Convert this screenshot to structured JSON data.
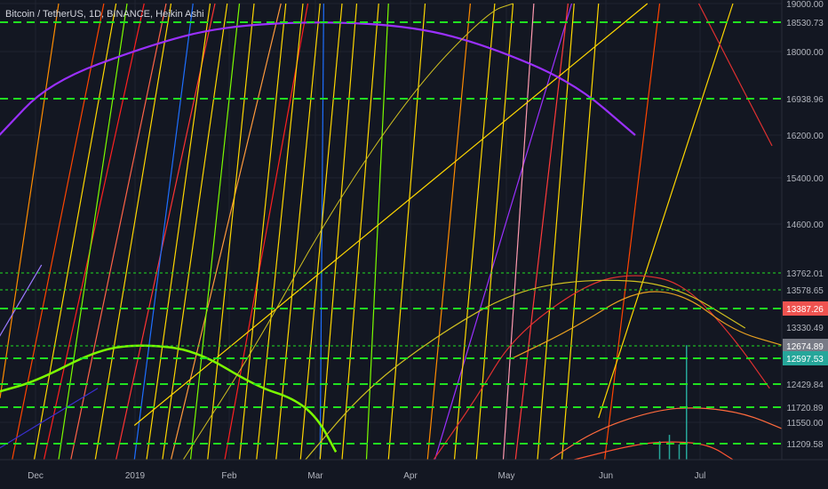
{
  "title": "Bitcoin / TetherUS, 1D, BINANCE, Heikin Ashi",
  "colors": {
    "background": "#131722",
    "axis_bg": "#1e222d",
    "axis_text": "#b2b5be",
    "grid": "#1f2330",
    "level_green": "#21e021",
    "price_red": "#ef5350",
    "price_gray": "#787b86",
    "price_green": "#26a69a"
  },
  "chart_data": {
    "type": "line",
    "title": "Bitcoin / TetherUS, 1D, BINANCE, Heikin Ashi",
    "ylim": [
      11000,
      19000
    ],
    "y_ticks": [
      "19000.00",
      "18000.00",
      "16200.00",
      "15400.00",
      "14600.00",
      "11550.00"
    ],
    "x_ticks": [
      "Dec",
      "2019",
      "Feb",
      "Mar",
      "Apr",
      "May",
      "Jun",
      "Jul"
    ],
    "levels": [
      {
        "value": 18530.73,
        "label": "18530.73",
        "style": "dashed"
      },
      {
        "value": 16938.96,
        "label": "16938.96",
        "style": "dashed"
      },
      {
        "value": 13762.01,
        "label": "13762.01",
        "style": "dotted"
      },
      {
        "value": 13578.65,
        "label": "13578.65",
        "style": "dotted"
      },
      {
        "value": 13387.26,
        "label": "13387.26",
        "style": "dashed",
        "tag": "red"
      },
      {
        "value": 13330.49,
        "label": "13330.49",
        "style": "none"
      },
      {
        "value": 12674.89,
        "label": "12674.89",
        "style": "dotted",
        "tag": "gray"
      },
      {
        "value": 12597.53,
        "label": "12597.53",
        "style": "dashed",
        "tag": "green"
      },
      {
        "value": 12429.84,
        "label": "12429.84",
        "style": "dashed"
      },
      {
        "value": 11720.89,
        "label": "11720.89",
        "style": "dashed"
      },
      {
        "value": 11209.58,
        "label": "11209.58",
        "style": "dashed"
      }
    ],
    "arcs": [
      {
        "color": "#9b30ff",
        "width": 2.2,
        "points": [
          [
            -0.5,
            16200
          ],
          [
            40,
            17300
          ],
          [
            120,
            18100
          ],
          [
            180,
            18450
          ],
          [
            262,
            18560
          ],
          [
            340,
            18450
          ],
          [
            400,
            18100
          ],
          [
            470,
            17300
          ],
          [
            520,
            16200
          ]
        ]
      },
      {
        "color": "#7cfc00",
        "width": 2.5,
        "points": [
          [
            -0.5,
            12200
          ],
          [
            30,
            12450
          ],
          [
            80,
            12650
          ],
          [
            115,
            12730
          ],
          [
            160,
            12650
          ],
          [
            210,
            12350
          ],
          [
            240,
            12000
          ],
          [
            260,
            11600
          ],
          [
            275,
            11100
          ]
        ]
      },
      {
        "color": "#e03030",
        "width": 1.2,
        "points": [
          [
            355,
            11000
          ],
          [
            390,
            12000
          ],
          [
            420,
            13000
          ],
          [
            480,
            13650
          ],
          [
            520,
            13760
          ],
          [
            560,
            13650
          ],
          [
            600,
            13000
          ],
          [
            630,
            12300
          ]
        ]
      },
      {
        "color": "#e8a020",
        "width": 1.2,
        "points": [
          [
            420,
            12600
          ],
          [
            470,
            13300
          ],
          [
            520,
            13578
          ],
          [
            560,
            13540
          ],
          [
            600,
            13200
          ],
          [
            640,
            12700
          ]
        ]
      },
      {
        "color": "#d0c020",
        "width": 1.2,
        "points": [
          [
            250,
            11000
          ],
          [
            300,
            12300
          ],
          [
            360,
            13100
          ],
          [
            420,
            13560
          ],
          [
            480,
            13700
          ],
          [
            550,
            13650
          ],
          [
            610,
            13300
          ]
        ]
      },
      {
        "color": "#ff6a3d",
        "width": 1.2,
        "points": [
          [
            450,
            11000
          ],
          [
            490,
            11450
          ],
          [
            540,
            11700
          ],
          [
            575,
            11720
          ],
          [
            610,
            11650
          ],
          [
            640,
            11450
          ]
        ]
      },
      {
        "color": "#ff5533",
        "width": 1.2,
        "points": [
          [
            470,
            11000
          ],
          [
            520,
            11200
          ],
          [
            550,
            11250
          ],
          [
            580,
            11200
          ],
          [
            600,
            11000
          ]
        ]
      },
      {
        "color": "#d0c020",
        "width": 1.0,
        "points": [
          [
            150,
            11000
          ],
          [
            210,
            12700
          ],
          [
            270,
            14800
          ],
          [
            340,
            17200
          ],
          [
            400,
            18800
          ],
          [
            420,
            19000
          ]
        ]
      }
    ],
    "rays": [
      {
        "color": "#ff8c00",
        "from": [
          0,
          12000
        ],
        "to": [
          48,
          19000
        ]
      },
      {
        "color": "#ff4500",
        "from": [
          10,
          11000
        ],
        "to": [
          85,
          19000
        ]
      },
      {
        "color": "#ffd700",
        "from": [
          28,
          11000
        ],
        "to": [
          95,
          19000
        ]
      },
      {
        "color": "#ff2020",
        "from": [
          36,
          11000
        ],
        "to": [
          118,
          19000
        ]
      },
      {
        "color": "#7cfc00",
        "from": [
          48,
          11000
        ],
        "to": [
          104,
          19000
        ]
      },
      {
        "color": "#ff6347",
        "from": [
          58,
          11000
        ],
        "to": [
          136,
          19000
        ]
      },
      {
        "color": "#ffd700",
        "from": [
          78,
          11000
        ],
        "to": [
          140,
          19000
        ]
      },
      {
        "color": "#ff3333",
        "from": [
          95,
          11000
        ],
        "to": [
          176,
          19000
        ]
      },
      {
        "color": "#1e6fff",
        "from": [
          110,
          11000
        ],
        "to": [
          158,
          19000
        ]
      },
      {
        "color": "#ffd700",
        "from": [
          120,
          11000
        ],
        "to": [
          172,
          19000
        ]
      },
      {
        "color": "#ffd700",
        "from": [
          133,
          11000
        ],
        "to": [
          186,
          19000
        ]
      },
      {
        "color": "#ff9a3c",
        "from": [
          140,
          11000
        ],
        "to": [
          230,
          19000
        ]
      },
      {
        "color": "#7cfc00",
        "from": [
          156,
          11000
        ],
        "to": [
          196,
          19000
        ]
      },
      {
        "color": "#ffd700",
        "from": [
          170,
          11000
        ],
        "to": [
          208,
          19000
        ]
      },
      {
        "color": "#ff2020",
        "from": [
          184,
          11000
        ],
        "to": [
          252,
          19000
        ]
      },
      {
        "color": "#ffd700",
        "from": [
          196,
          11000
        ],
        "to": [
          234,
          19000
        ]
      },
      {
        "color": "#ffd700",
        "from": [
          210,
          11000
        ],
        "to": [
          248,
          19000
        ]
      },
      {
        "color": "#ffd700",
        "from": [
          226,
          11000
        ],
        "to": [
          262,
          19000
        ]
      },
      {
        "color": "#1e6fff",
        "from": [
          262,
          11000
        ],
        "to": [
          265,
          19000
        ]
      },
      {
        "color": "#ffd700",
        "from": [
          246,
          11000
        ],
        "to": [
          280,
          19000
        ]
      },
      {
        "color": "#ffd700",
        "from": [
          262,
          11000
        ],
        "to": [
          292,
          19000
        ]
      },
      {
        "color": "#ffd700",
        "from": [
          280,
          11000
        ],
        "to": [
          310,
          19000
        ]
      },
      {
        "color": "#7cfc00",
        "from": [
          300,
          11000
        ],
        "to": [
          318,
          19000
        ]
      },
      {
        "color": "#ffd700",
        "from": [
          318,
          11000
        ],
        "to": [
          348,
          19000
        ]
      },
      {
        "color": "#ff8c00",
        "from": [
          350,
          11000
        ],
        "to": [
          385,
          19000
        ]
      },
      {
        "color": "#9b30ff",
        "from": [
          356,
          11000
        ],
        "to": [
          468,
          19000
        ]
      },
      {
        "color": "#ffd700",
        "from": [
          372,
          11000
        ],
        "to": [
          405,
          19000
        ]
      },
      {
        "color": "#ffd700",
        "from": [
          390,
          11000
        ],
        "to": [
          420,
          19000
        ]
      },
      {
        "color": "#ff9ab0",
        "from": [
          412,
          11000
        ],
        "to": [
          437,
          19000
        ]
      },
      {
        "color": "#ff3a3a",
        "from": [
          422,
          11000
        ],
        "to": [
          465,
          19000
        ]
      },
      {
        "color": "#ffd700",
        "from": [
          440,
          11000
        ],
        "to": [
          470,
          19000
        ]
      },
      {
        "color": "#ffd700",
        "from": [
          460,
          11000
        ],
        "to": [
          490,
          19000
        ]
      },
      {
        "color": "#ff4400",
        "from": [
          495,
          11000
        ],
        "to": [
          540,
          19000
        ]
      },
      {
        "color": "#ffd700",
        "from": [
          490,
          11600
        ],
        "to": [
          600,
          19000
        ]
      },
      {
        "color": "#e03030",
        "from": [
          572,
          19000
        ],
        "to": [
          632,
          16000
        ]
      },
      {
        "color": "#ffd700",
        "from": [
          110,
          11500
        ],
        "to": [
          530,
          19000
        ]
      },
      {
        "color": "#3a2fd0",
        "from": [
          -0.5,
          11150
        ],
        "to": [
          80,
          12300
        ]
      },
      {
        "color": "#9b7aff",
        "from": [
          -0.5,
          13000
        ],
        "to": [
          34,
          13900
        ]
      }
    ],
    "spikes": [
      {
        "x": 562,
        "top": 12700,
        "color": "#26a69a"
      },
      {
        "x": 556,
        "top": 11200,
        "color": "#26a69a"
      },
      {
        "x": 548,
        "top": 11350,
        "color": "#26a69a"
      },
      {
        "x": 540,
        "top": 11250,
        "color": "#26a69a"
      }
    ]
  }
}
